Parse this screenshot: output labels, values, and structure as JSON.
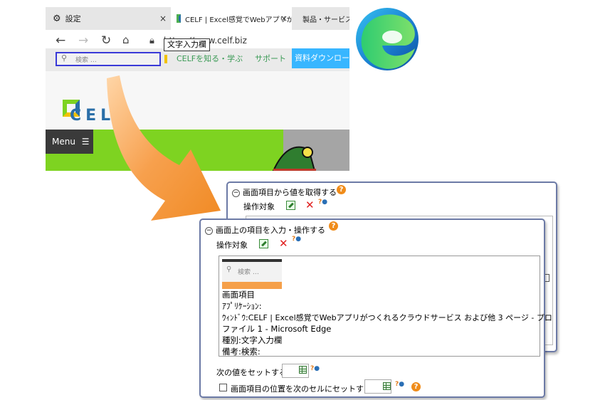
{
  "browser": {
    "tabs": [
      {
        "label": "設定",
        "icon": "gear-icon"
      },
      {
        "label": "CELF | Excel感覚でWebアプリがつくれ",
        "icon": "celf-favicon"
      },
      {
        "label": "製品・サービス",
        "icon": "site-favicon"
      }
    ],
    "tab_close": "×",
    "url": "https://www.celf.biz",
    "search_placeholder": "検索 …",
    "tooltip": "文字入力欄",
    "nav_links": [
      "CELFを知る・学ぶ",
      "サポート"
    ],
    "download_button": "資料ダウンロード",
    "logo_text": "CELF",
    "menu_label": "Menu"
  },
  "panel_back": {
    "title": "画面項目から値を取得する",
    "target_label": "操作対象"
  },
  "panel_front": {
    "title": "画面上の項目を入力・操作する",
    "target_label": "操作対象",
    "thumb_placeholder": "検索 …",
    "info_lines": [
      "画面項目",
      "ｱﾌﾟﾘｹｰｼｮﾝ:",
      "ｳｨﾝﾄﾞｳ:CELF | Excel感覚でWebアプリがつくれるクラウドサービス および他 3 ページ - プロ",
      "ファイル 1 - Microsoft Edge",
      "種別:文字入力欄",
      "備考:検索:"
    ],
    "set_value_label": "次の値をセットする",
    "set_position_label": "画面項目の位置を次のセルにセットする"
  },
  "colors": {
    "accent_orange": "#f5a04a",
    "panel_border": "#6c7aa6",
    "celf_green": "#7ed321",
    "download_blue": "#38b6ff"
  }
}
